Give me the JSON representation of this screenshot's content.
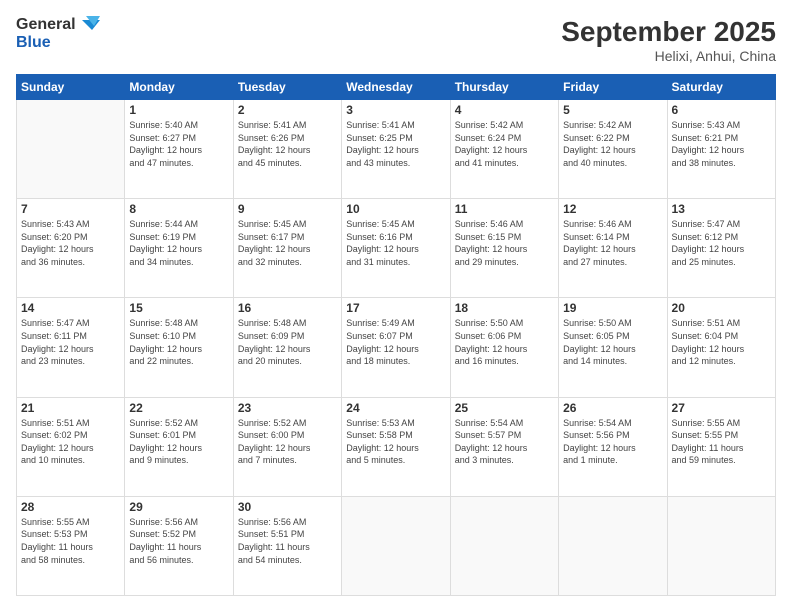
{
  "header": {
    "logo_general": "General",
    "logo_blue": "Blue",
    "month_title": "September 2025",
    "location": "Helixi, Anhui, China"
  },
  "weekdays": [
    "Sunday",
    "Monday",
    "Tuesday",
    "Wednesday",
    "Thursday",
    "Friday",
    "Saturday"
  ],
  "weeks": [
    [
      {
        "day": "",
        "info": ""
      },
      {
        "day": "1",
        "info": "Sunrise: 5:40 AM\nSunset: 6:27 PM\nDaylight: 12 hours\nand 47 minutes."
      },
      {
        "day": "2",
        "info": "Sunrise: 5:41 AM\nSunset: 6:26 PM\nDaylight: 12 hours\nand 45 minutes."
      },
      {
        "day": "3",
        "info": "Sunrise: 5:41 AM\nSunset: 6:25 PM\nDaylight: 12 hours\nand 43 minutes."
      },
      {
        "day": "4",
        "info": "Sunrise: 5:42 AM\nSunset: 6:24 PM\nDaylight: 12 hours\nand 41 minutes."
      },
      {
        "day": "5",
        "info": "Sunrise: 5:42 AM\nSunset: 6:22 PM\nDaylight: 12 hours\nand 40 minutes."
      },
      {
        "day": "6",
        "info": "Sunrise: 5:43 AM\nSunset: 6:21 PM\nDaylight: 12 hours\nand 38 minutes."
      }
    ],
    [
      {
        "day": "7",
        "info": "Sunrise: 5:43 AM\nSunset: 6:20 PM\nDaylight: 12 hours\nand 36 minutes."
      },
      {
        "day": "8",
        "info": "Sunrise: 5:44 AM\nSunset: 6:19 PM\nDaylight: 12 hours\nand 34 minutes."
      },
      {
        "day": "9",
        "info": "Sunrise: 5:45 AM\nSunset: 6:17 PM\nDaylight: 12 hours\nand 32 minutes."
      },
      {
        "day": "10",
        "info": "Sunrise: 5:45 AM\nSunset: 6:16 PM\nDaylight: 12 hours\nand 31 minutes."
      },
      {
        "day": "11",
        "info": "Sunrise: 5:46 AM\nSunset: 6:15 PM\nDaylight: 12 hours\nand 29 minutes."
      },
      {
        "day": "12",
        "info": "Sunrise: 5:46 AM\nSunset: 6:14 PM\nDaylight: 12 hours\nand 27 minutes."
      },
      {
        "day": "13",
        "info": "Sunrise: 5:47 AM\nSunset: 6:12 PM\nDaylight: 12 hours\nand 25 minutes."
      }
    ],
    [
      {
        "day": "14",
        "info": "Sunrise: 5:47 AM\nSunset: 6:11 PM\nDaylight: 12 hours\nand 23 minutes."
      },
      {
        "day": "15",
        "info": "Sunrise: 5:48 AM\nSunset: 6:10 PM\nDaylight: 12 hours\nand 22 minutes."
      },
      {
        "day": "16",
        "info": "Sunrise: 5:48 AM\nSunset: 6:09 PM\nDaylight: 12 hours\nand 20 minutes."
      },
      {
        "day": "17",
        "info": "Sunrise: 5:49 AM\nSunset: 6:07 PM\nDaylight: 12 hours\nand 18 minutes."
      },
      {
        "day": "18",
        "info": "Sunrise: 5:50 AM\nSunset: 6:06 PM\nDaylight: 12 hours\nand 16 minutes."
      },
      {
        "day": "19",
        "info": "Sunrise: 5:50 AM\nSunset: 6:05 PM\nDaylight: 12 hours\nand 14 minutes."
      },
      {
        "day": "20",
        "info": "Sunrise: 5:51 AM\nSunset: 6:04 PM\nDaylight: 12 hours\nand 12 minutes."
      }
    ],
    [
      {
        "day": "21",
        "info": "Sunrise: 5:51 AM\nSunset: 6:02 PM\nDaylight: 12 hours\nand 10 minutes."
      },
      {
        "day": "22",
        "info": "Sunrise: 5:52 AM\nSunset: 6:01 PM\nDaylight: 12 hours\nand 9 minutes."
      },
      {
        "day": "23",
        "info": "Sunrise: 5:52 AM\nSunset: 6:00 PM\nDaylight: 12 hours\nand 7 minutes."
      },
      {
        "day": "24",
        "info": "Sunrise: 5:53 AM\nSunset: 5:58 PM\nDaylight: 12 hours\nand 5 minutes."
      },
      {
        "day": "25",
        "info": "Sunrise: 5:54 AM\nSunset: 5:57 PM\nDaylight: 12 hours\nand 3 minutes."
      },
      {
        "day": "26",
        "info": "Sunrise: 5:54 AM\nSunset: 5:56 PM\nDaylight: 12 hours\nand 1 minute."
      },
      {
        "day": "27",
        "info": "Sunrise: 5:55 AM\nSunset: 5:55 PM\nDaylight: 11 hours\nand 59 minutes."
      }
    ],
    [
      {
        "day": "28",
        "info": "Sunrise: 5:55 AM\nSunset: 5:53 PM\nDaylight: 11 hours\nand 58 minutes."
      },
      {
        "day": "29",
        "info": "Sunrise: 5:56 AM\nSunset: 5:52 PM\nDaylight: 11 hours\nand 56 minutes."
      },
      {
        "day": "30",
        "info": "Sunrise: 5:56 AM\nSunset: 5:51 PM\nDaylight: 11 hours\nand 54 minutes."
      },
      {
        "day": "",
        "info": ""
      },
      {
        "day": "",
        "info": ""
      },
      {
        "day": "",
        "info": ""
      },
      {
        "day": "",
        "info": ""
      }
    ]
  ]
}
